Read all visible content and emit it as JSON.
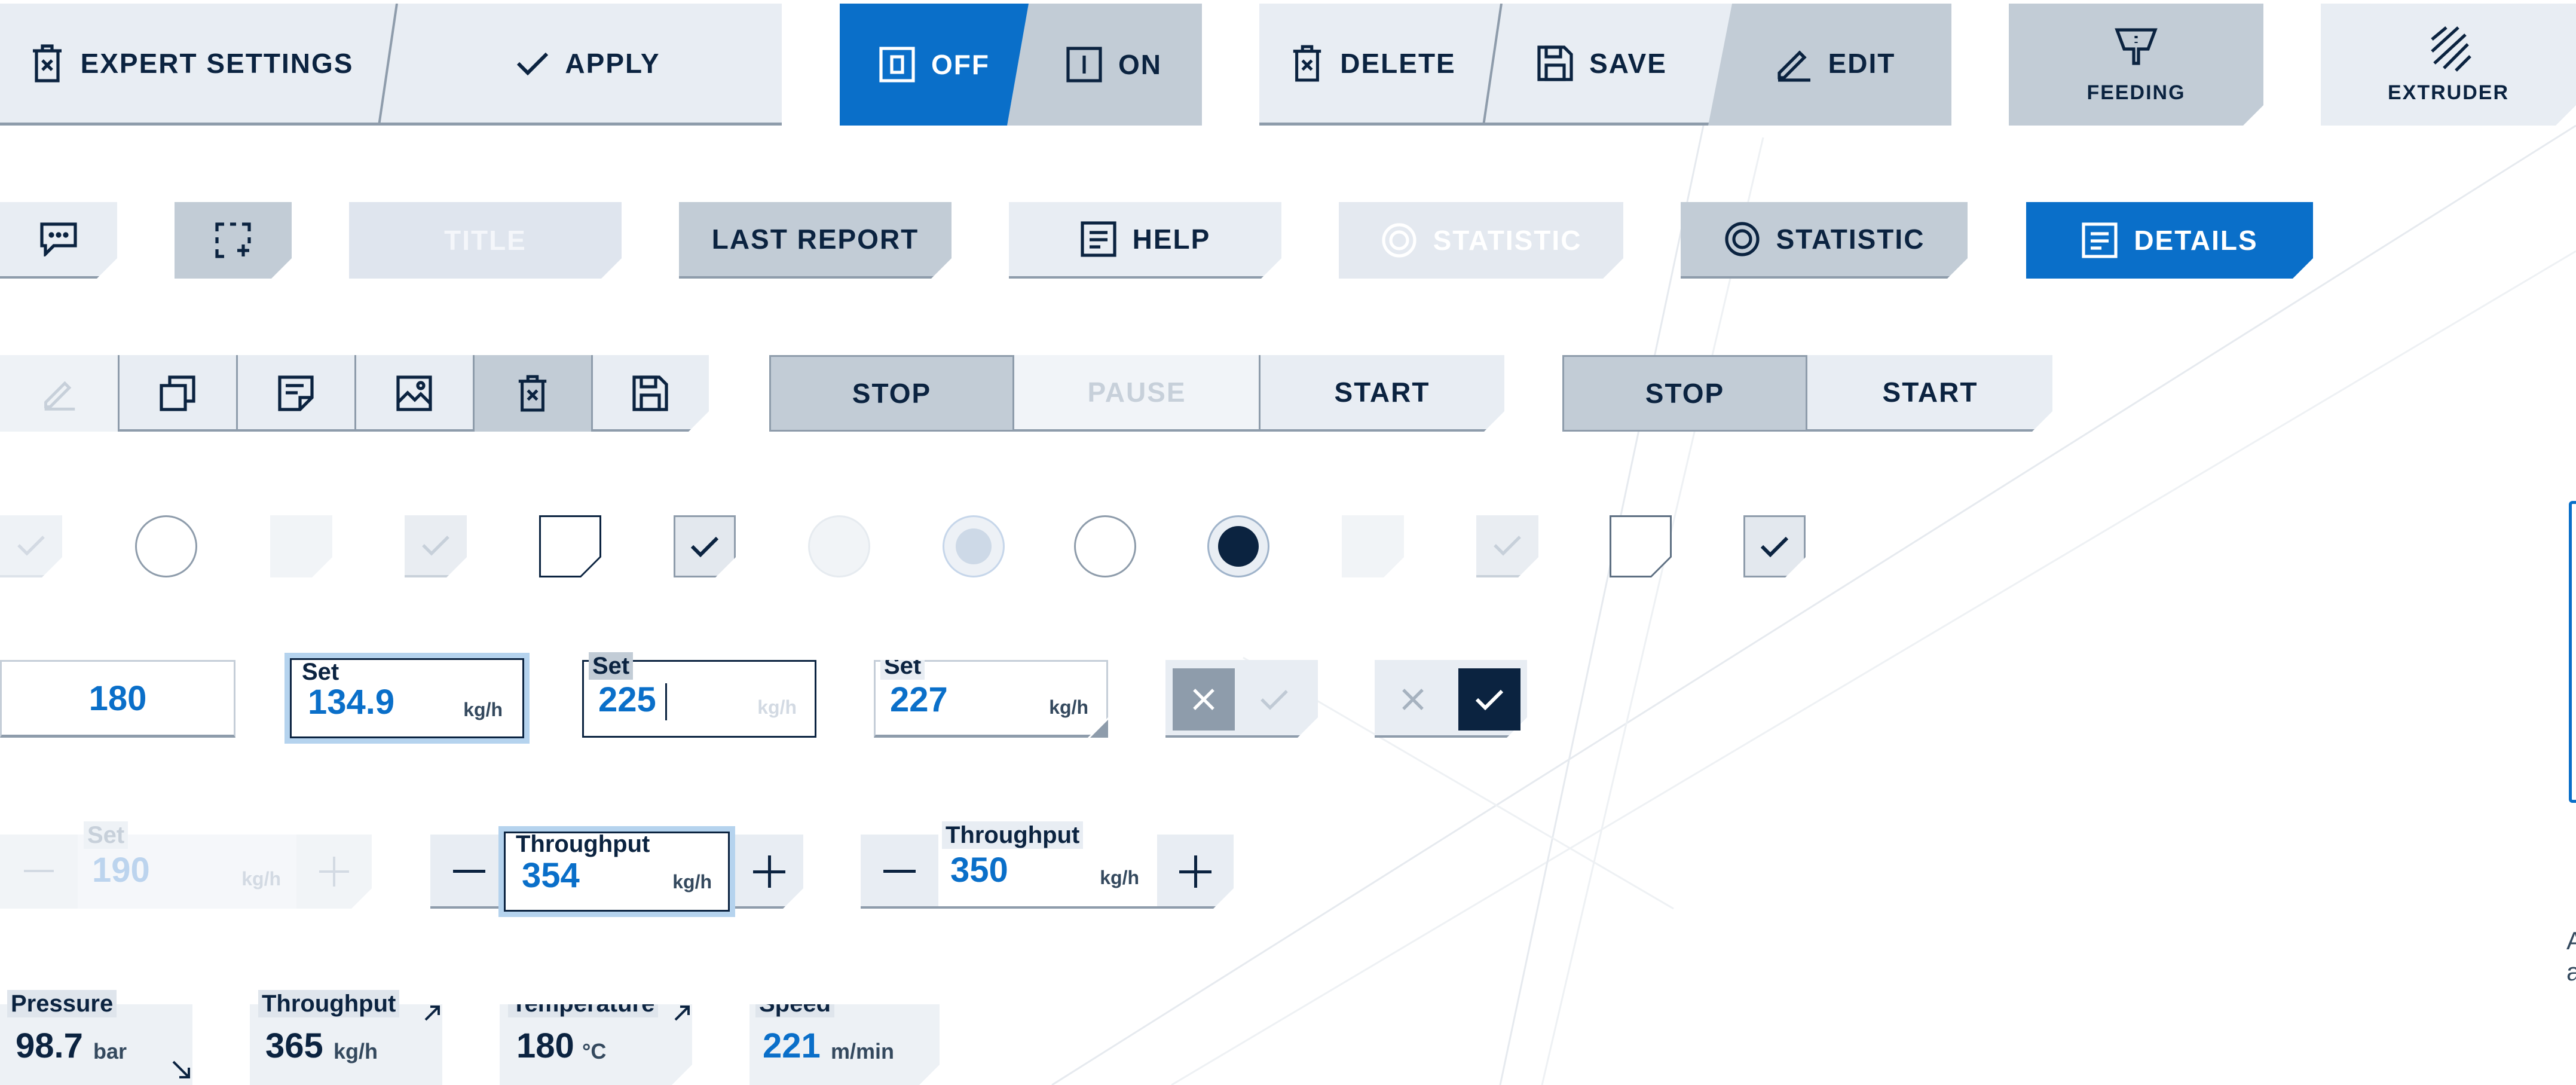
{
  "colors": {
    "navy": "#0b2340",
    "blue": "#0a6fc9",
    "light": "#e8edf3",
    "mid": "#c2ccd6",
    "disabled": "#dfe5ee"
  },
  "row1": {
    "expert_settings": "EXPERT SETTINGS",
    "apply": "APPLY",
    "off": "OFF",
    "on": "ON",
    "delete": "DELETE",
    "save": "SAVE",
    "edit": "EDIT",
    "feeding": "FEEDING",
    "extruder": "EXTRUDER"
  },
  "row2": {
    "title": "TITLE",
    "last_report": "LAST REPORT",
    "help": "HELP",
    "statistic_disabled": "STATISTIC",
    "statistic": "STATISTIC",
    "details": "DETAILS"
  },
  "row3": {
    "stop_1": "STOP",
    "pause": "PAUSE",
    "start_1": "START",
    "stop_2": "STOP",
    "start_2": "START"
  },
  "row5": {
    "value_plain": "180",
    "field_a": {
      "label": "Set",
      "value": "134.9",
      "unit": "kg/h"
    },
    "field_b": {
      "label": "Set",
      "value": "225",
      "unit": "kg/h"
    },
    "field_c": {
      "label": "Set",
      "value": "227",
      "unit": "kg/h"
    }
  },
  "row6": {
    "stepper_disabled": {
      "label": "Set",
      "value": "190",
      "unit": "kg/h"
    },
    "stepper_active": {
      "label": "Throughput",
      "value": "354",
      "unit": "kg/h"
    },
    "stepper_normal": {
      "label": "Throughput",
      "value": "350",
      "unit": "kg/h"
    }
  },
  "row7": {
    "pressure": {
      "label": "Pressure",
      "value": "98.7",
      "unit": "bar"
    },
    "throughput": {
      "label": "Throughput",
      "value": "365",
      "unit": "kg/h"
    },
    "temperature": {
      "label": "Temperature",
      "value": "180",
      "unit": "°C"
    },
    "speed": {
      "label": "Speed",
      "value": "221",
      "unit": "m/min"
    }
  },
  "edge_text": {
    "line1": "A",
    "line2": "a"
  }
}
